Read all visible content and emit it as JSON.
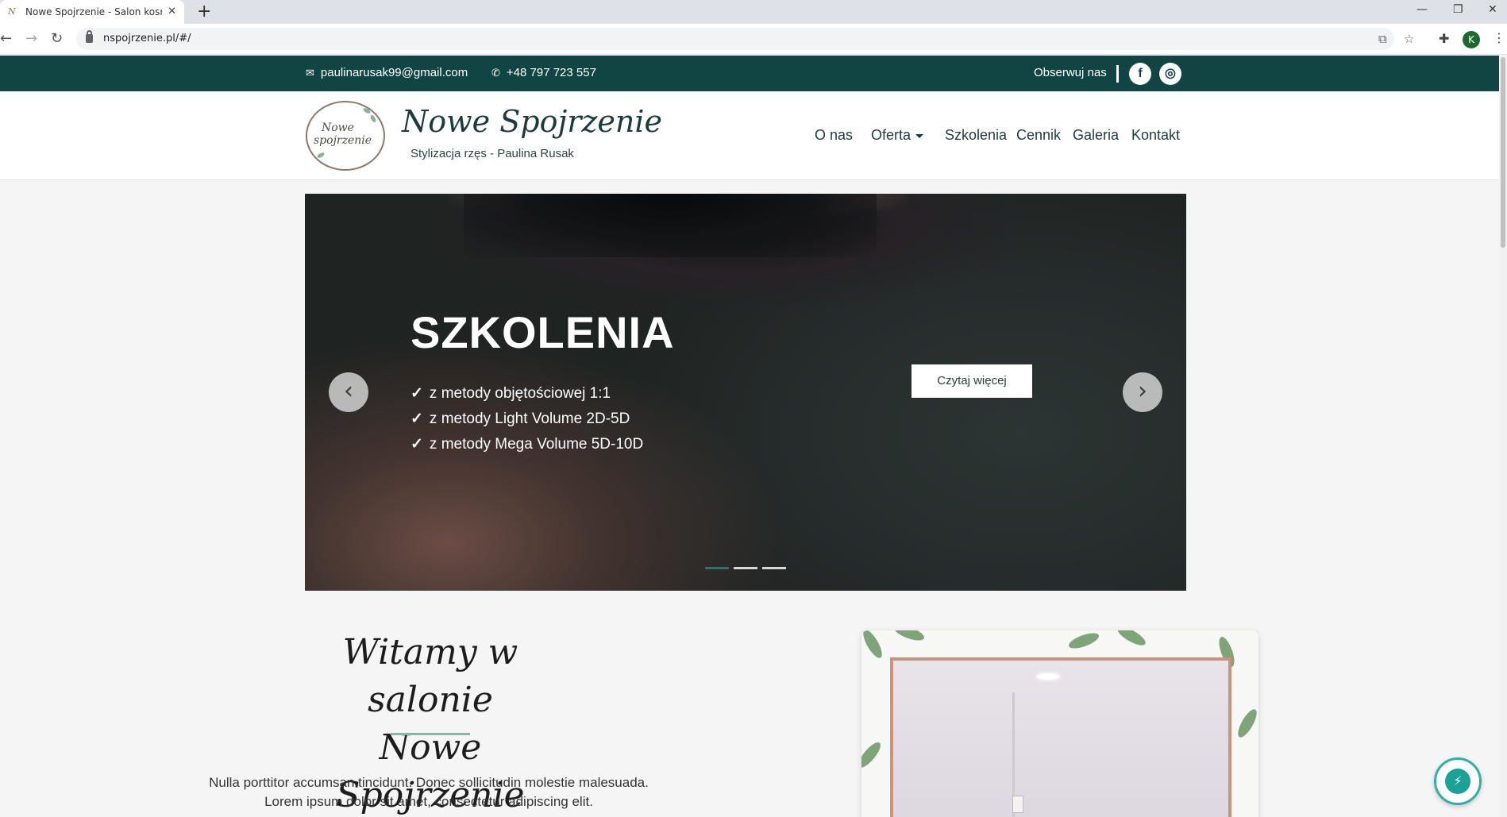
{
  "browser": {
    "tab_title": "Nowe Spojrzenie - Salon kosmet",
    "tab_favicon": "N",
    "url": "nspojrzenie.pl/#/",
    "profile_initial": "K"
  },
  "topbar": {
    "email": "paulinarusak99@gmail.com",
    "phone": "+48 797 723 557",
    "follow_label": "Obserwuj nas",
    "facebook_glyph": "f",
    "instagram_glyph": "◎"
  },
  "header": {
    "logo_text_line1": "Nowe",
    "logo_text_line2": "spojrzenie",
    "brand": "Nowe Spojrzenie",
    "tagline": "Stylizacja rzęs - Paulina Rusak",
    "nav": {
      "about": "O nas",
      "offer": "Oferta",
      "trainings": "Szkolenia",
      "prices": "Cennik",
      "gallery": "Galeria",
      "contact": "Kontakt"
    }
  },
  "hero": {
    "title": "SZKOLENIA",
    "items": [
      "z metody objętościowej 1:1",
      "z metody Light Volume 2D-5D",
      "z metody Mega Volume 5D-10D"
    ],
    "check": "✓",
    "button": "Czytaj więcej",
    "prev_glyph": "‹",
    "next_glyph": "›",
    "slide_count": 3,
    "active_slide": 1
  },
  "welcome": {
    "line1": "Witamy w salonie",
    "line2": "Nowe Spojrzenie",
    "body": "Nulla porttitor accumsan tincidunt. Donec sollicitudin molestie malesuada. Lorem ipsum dolor sit amet, consectetur adipiscing elit."
  },
  "icons": {
    "mail": "✉",
    "phone": "✆",
    "messenger": "⚡"
  }
}
